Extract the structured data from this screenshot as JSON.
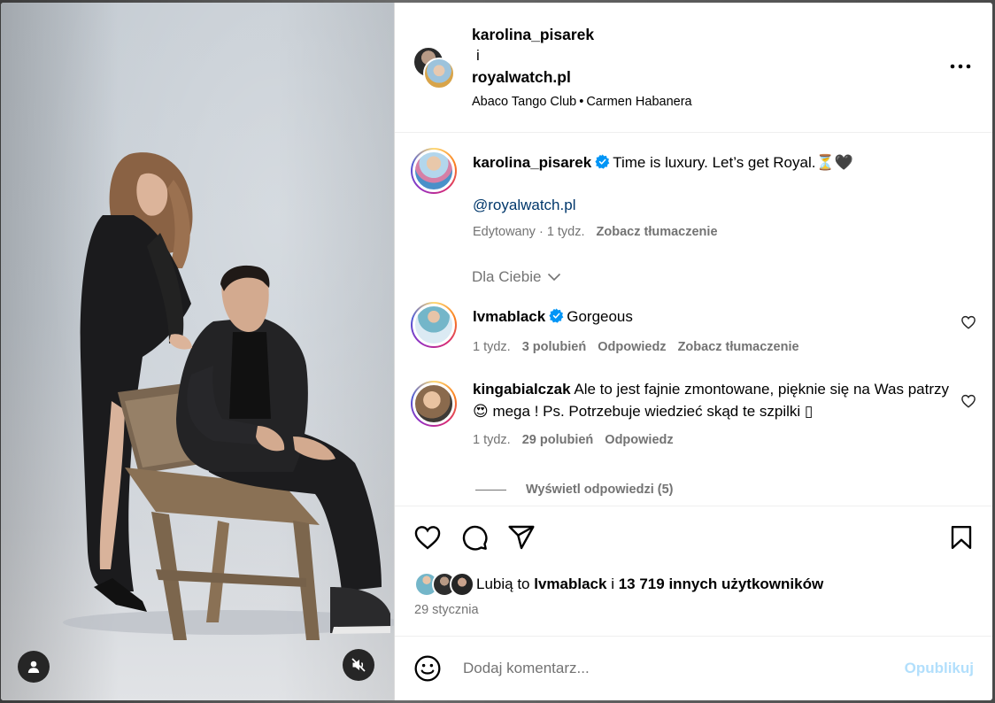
{
  "header": {
    "user1": "karolina_pisarek",
    "and": "i",
    "user2": "royalwatch.pl",
    "location": "Abaco Tango Club",
    "dot": "•",
    "audio": "Carmen Habanera"
  },
  "caption": {
    "username": "karolina_pisarek",
    "text": "Time is luxury. Let’s get Royal.⏳🖤",
    "mention": "@royalwatch.pl",
    "edited": "Edytowany · 1 tydz.",
    "translate": "Zobacz tłumaczenie"
  },
  "for_you": "Dla Ciebie",
  "comments": [
    {
      "username": "lvmablack",
      "text": "Gorgeous",
      "time": "1 tydz.",
      "likes": "3 polubień",
      "reply": "Odpowiedz",
      "translate": "Zobacz tłumaczenie"
    },
    {
      "username": "kingabialczak",
      "text": "Ale to jest fajnie zmontowane, pięknie się na Was patrzy 😍 mega ! Ps. Potrzebuje wiedzieć skąd te szpilki ▯",
      "time": "1 tydz.",
      "likes": "29 polubień",
      "reply": "Odpowiedz"
    }
  ],
  "view_replies": "Wyświetl odpowiedzi (5)",
  "likes_line": {
    "prefix": "Lubią to",
    "user": "lvmablack",
    "middle": "i",
    "count": "13 719 innych użytkowników"
  },
  "date": "29 stycznia",
  "add_comment": {
    "placeholder": "Dodaj komentarz...",
    "publish": "Opublikuj"
  },
  "colors": {
    "verified": "#0095f6",
    "link": "#00376b",
    "muted": "#737373",
    "publish_disabled": "#b2dffc"
  },
  "icons": [
    "user-icon",
    "mute-icon",
    "more-icon",
    "verified-icon",
    "chevron-down-icon",
    "heart-icon",
    "comment-icon",
    "share-icon",
    "bookmark-icon",
    "emoji-icon"
  ]
}
